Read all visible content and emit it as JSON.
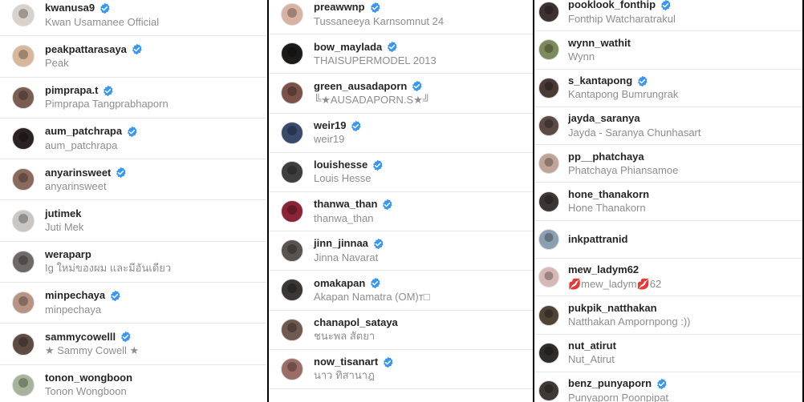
{
  "colors": {
    "verified": "#3897f0",
    "username": "#262626",
    "fullname": "#8e8e8e",
    "divider": "#e6e6e6",
    "gutter": "#000000"
  },
  "columns": [
    {
      "rows": [
        {
          "username": "kwanusa9",
          "fullname": "Kwan Usamanee Official",
          "verified": true,
          "avatar": "#d9d2cc"
        },
        {
          "username": "peakpattarasaya",
          "fullname": "Peak",
          "verified": true,
          "avatar": "#d8b79a"
        },
        {
          "username": "pimprapa.t",
          "fullname": "Pimprapa Tangprabhaporn",
          "verified": true,
          "avatar": "#7a5e52"
        },
        {
          "username": "aum_patchrapa",
          "fullname": "aum_patchrapa",
          "verified": true,
          "avatar": "#2a2322"
        },
        {
          "username": "anyarinsweet",
          "fullname": "anyarinsweet",
          "verified": true,
          "avatar": "#8b6a5e"
        },
        {
          "username": "jutimek",
          "fullname": "Juti Mek",
          "verified": false,
          "avatar": "#c9c6c4"
        },
        {
          "username": "weraparp",
          "fullname": "Ig ใหม่ของผม และมีอันเดียว",
          "verified": false,
          "avatar": "#6f6a68"
        },
        {
          "username": "minpechaya",
          "fullname": "minpechaya",
          "verified": true,
          "avatar": "#b79484"
        },
        {
          "username": "sammycowelll",
          "fullname": "★ Sammy Cowell ★",
          "verified": true,
          "avatar": "#5e4b43"
        },
        {
          "username": "tonon_wongboon",
          "fullname": "Tonon Wongboon",
          "verified": false,
          "avatar": "#a7b39a"
        }
      ]
    },
    {
      "rows": [
        {
          "username": "preawwnp",
          "fullname": "Tussaneeya Karnsomnut 24",
          "verified": true,
          "avatar": "#d8b2a2"
        },
        {
          "username": "bow_maylada",
          "fullname": "THAISUPERMODEL 2013",
          "verified": true,
          "avatar": "#1d1a1a"
        },
        {
          "username": "green_ausadaporn",
          "fullname": "╚★AUSADAPORN.S★╝",
          "verified": true,
          "avatar": "#7b5349"
        },
        {
          "username": "weir19",
          "fullname": "weir19",
          "verified": true,
          "avatar": "#3a4a6b"
        },
        {
          "username": "louishesse",
          "fullname": "Louis Hesse",
          "verified": true,
          "avatar": "#3f3f3f"
        },
        {
          "username": "thanwa_than",
          "fullname": "thanwa_than",
          "verified": true,
          "avatar": "#8a2436"
        },
        {
          "username": "jinn_jinnaa",
          "fullname": "Jinna Navarat",
          "verified": true,
          "avatar": "#5a5350"
        },
        {
          "username": "omakapan",
          "fullname": "Akapan Namatra (OM)т□",
          "verified": true,
          "avatar": "#3a3736"
        },
        {
          "username": "chanapol_sataya",
          "fullname": "ชนะพล สัตยา",
          "verified": false,
          "avatar": "#6e5a4f"
        },
        {
          "username": "now_tisanart",
          "fullname": "นาว ทิสานาฎ",
          "verified": true,
          "avatar": "#9a6e66"
        }
      ]
    },
    {
      "rows": [
        {
          "username": "pooklook_fonthip",
          "fullname": "Fonthip Watcharatrakul",
          "verified": true,
          "avatar": "#3d3431"
        },
        {
          "username": "wynn_wathit",
          "fullname": "Wynn",
          "verified": false,
          "avatar": "#7c8a5c"
        },
        {
          "username": "s_kantapong",
          "fullname": "Kantapong Bumrungrak",
          "verified": true,
          "avatar": "#4a3b37"
        },
        {
          "username": "jayda_saranya",
          "fullname": "Jayda - Saranya Chunhasart",
          "verified": false,
          "avatar": "#5b4a45"
        },
        {
          "username": "pp__phatchaya",
          "fullname": "Phatchaya Phiansamoe",
          "verified": false,
          "avatar": "#bfa597"
        },
        {
          "username": "hone_thanakorn",
          "fullname": "Hone Thanakorn",
          "verified": false,
          "avatar": "#3b3634"
        },
        {
          "username": "inkpattranid",
          "fullname": "",
          "verified": false,
          "avatar": "#8aa0b0"
        },
        {
          "username": "mew_ladym62",
          "fullname": "💋mew_ladym💋62",
          "verified": false,
          "avatar": "#d6b9b6"
        },
        {
          "username": "pukpik_natthakan",
          "fullname": "Natthakan Ampornpong :))",
          "verified": false,
          "avatar": "#4f4436"
        },
        {
          "username": "nut_atirut",
          "fullname": "Nut_Atirut",
          "verified": false,
          "avatar": "#2f2c2b"
        },
        {
          "username": "benz_punyaporn",
          "fullname": "Punyaporn Poonpipat",
          "verified": true,
          "avatar": "#403834"
        }
      ]
    }
  ]
}
